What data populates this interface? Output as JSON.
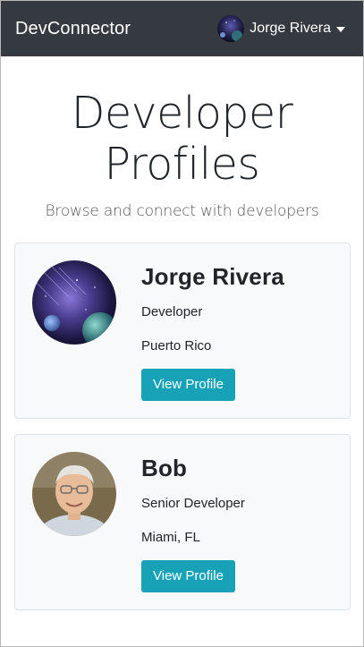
{
  "navbar": {
    "brand": "DevConnector",
    "user_name": "Jorge Rivera",
    "background": "#343a40"
  },
  "hero": {
    "title_line1": "Developer",
    "title_line2": "Profiles",
    "lead": "Browse and connect with developers"
  },
  "profiles": [
    {
      "name": "Jorge Rivera",
      "title": "Developer",
      "location": "Puerto Rico",
      "button_label": "View Profile",
      "avatar": "space-nebula-avatar"
    },
    {
      "name": "Bob",
      "title": "Senior Developer",
      "location": "Miami, FL",
      "button_label": "View Profile",
      "avatar": "man-with-glasses-photo"
    }
  ],
  "colors": {
    "accent": "#17a2b8",
    "card_background": "#f8f9fa"
  }
}
